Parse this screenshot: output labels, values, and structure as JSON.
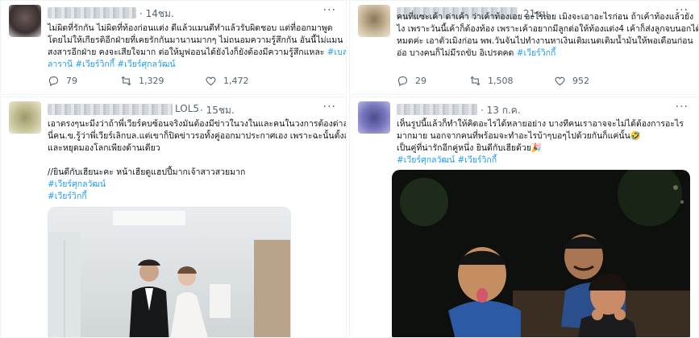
{
  "tweets": [
    {
      "time": "· 14ชม.",
      "lines": [
        "ไม่ผิดที่รักกัน ไม่ผิดที่ท้องก่อนแต่ง ดีแล้วแมนดีทำแล้วรับผิดชอบ แต่ที่ออกมาพูด",
        "โดยไม่ให้เกียรติอีกฝ่ายที่เคยรักกันมานานมากๆ ไม่ถนอมความรู้สึกกัน อันนี้ไม่แมน",
        "สงสารอีกฝ่าย คงจะเสียใจมาก ต่อให้มูฟออนได้ยังไงก็ยังต้องมีความรู้สึกแหละ"
      ],
      "tags": [
        "#เบล",
        "ลารานี",
        "#เวียร์วิกกี้",
        "#เวียร์ศุกลวัฒน์"
      ],
      "reply_count": "79",
      "retweet_count": "1,329",
      "like_count": "1,472"
    },
    {
      "time": "21ชม.",
      "lines": [
        "คนที่แซะเค้า ด่าเค้า ว่าเค้าท้องเอย อะไรเอย เมิงจะเอาอะไรก่อน ถ้าเค้าท้องแล้วยัง",
        "ไง เพราะวันนี้เค้าก็ต้องท้อง เพราะเค้าอยากมีลูกต่อให้ท้องแต่ง4 เค้าก็ส่งลูกจบนอกได้",
        "หมดค่ะ เอาตัวเมิงก่อน พพ.วันจันไปทำงานหาเงินเติมเนตเติมน้ำมันให้พอเดือนก่อน",
        "อ่อ บางคนก็ไม่มีรถขับ อิเปรตคด"
      ],
      "tags": [
        "#เวียร์วิกกี้"
      ],
      "reply_count": "29",
      "retweet_count": "1,508",
      "like_count": "952"
    },
    {
      "name_tail": "LOL5",
      "time": "· 15ชม.",
      "lines": [
        "เอาตรงๆนะมีงว่าถ้าพี่เวียร์คบซ้อนจริงมันต้องมีข่าวในวงในและคนในวงการต้องด่าละ แต่",
        "นี่คน.ข.รู้ว่าพี่เวียร์เลิกบล.แต่เขาก็ปิดข่าวรอทั้งคู่ออกมาประกาศเอง เพราะฉะนั้นตั้งสติ",
        "และหยุดมองโลกเพียงด้านเดียว",
        "",
        "//ยินดีกับเฮียนะคะ หน้าเฮียดูแฮปปี้มากเจ้าสาวสวยมาก"
      ],
      "tags": [
        "#เวียร์ศุกลวัฒน์",
        "#เวียร์วิกกี้"
      ]
    },
    {
      "time": "· 13 ก.ค.",
      "lines": [
        "เห็นรูปนี้แล้วก็ทำให้คิดอะไรได้หลายอย่าง บางทีคนเราอาจจะไม่ได้ต้องการอะไร",
        "มากมาย นอกจากคนที่พร้อมจะทำอะไรบ้าๆบอๆไปด้วยกันก็แค่นั้น🤣",
        "เป็นคู่ที่น่ารักอีกคู่หนึ่ง ยินดีกับเฮียด้วย🎉"
      ],
      "tags": [
        "#เวียร์ศุกลวัฒน์",
        "#เวียร์วิกกี้"
      ]
    }
  ],
  "colors": {
    "link": "#1d9bf0",
    "muted": "#536471",
    "text": "#0f1419"
  },
  "icons": [
    "reply-icon",
    "retweet-icon",
    "like-icon",
    "more-icon"
  ]
}
